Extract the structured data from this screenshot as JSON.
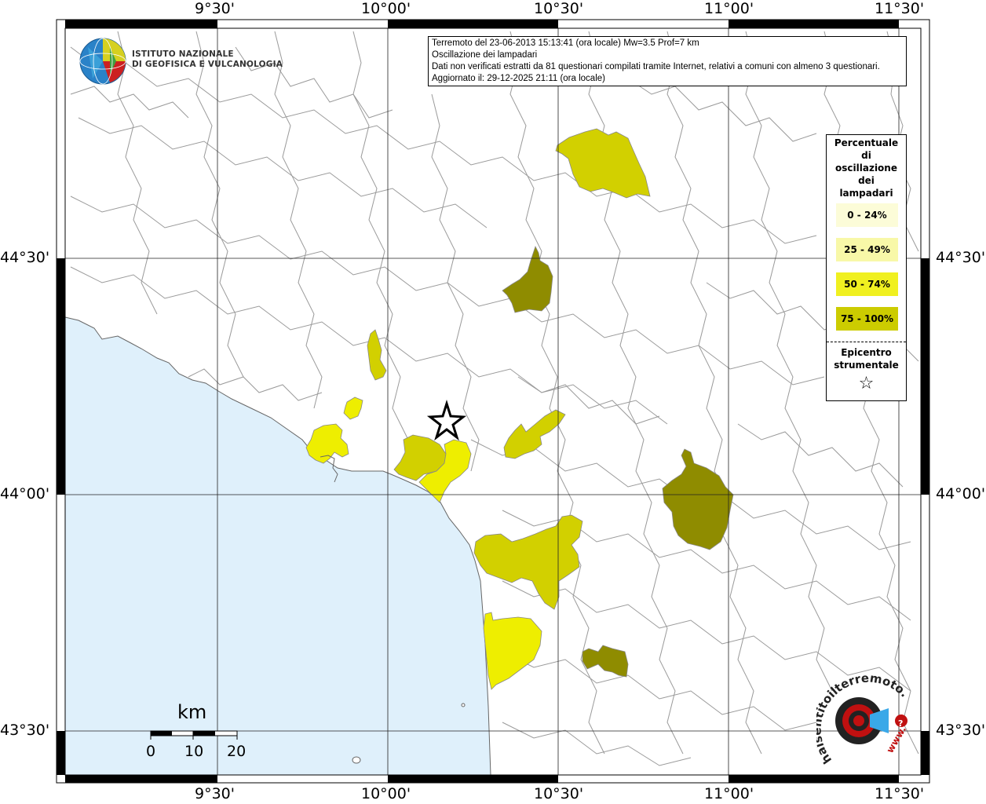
{
  "info": {
    "line1": "Terremoto del 23-06-2013 15:13:41 (ora locale) Mw=3.5 Prof=7 km",
    "line2": "Oscillazione dei lampadari",
    "line3": "Dati non verificati estratti da 81 questionari compilati tramite Internet, relativi a comuni con almeno 3 questionari.",
    "line4": "Aggiornato il: 29-12-2025 21:11 (ora locale)"
  },
  "logo": {
    "line1": "ISTITUTO NAZIONALE",
    "line2": "DI GEOFISICA E VULCANOLOGIA"
  },
  "axes": {
    "top": [
      "9°30'",
      "10°00'",
      "10°30'",
      "11°00'",
      "11°30'"
    ],
    "bottom": [
      "9°30'",
      "10°00'",
      "10°30'",
      "11°00'",
      "11°30'"
    ],
    "left": [
      "44°30'",
      "44°00'",
      "43°30'"
    ],
    "right": [
      "44°30'",
      "44°00'",
      "43°30'"
    ]
  },
  "legend": {
    "title": "Percentuale di oscillazione dei lampadari",
    "classes": [
      {
        "label": "0 - 24%",
        "color": "#fcfcd8"
      },
      {
        "label": "25 - 49%",
        "color": "#f8f8a8"
      },
      {
        "label": "50 - 74%",
        "color": "#f0f020"
      },
      {
        "label": "75 - 100%",
        "color": "#cccc00"
      }
    ],
    "epicenter_title": "Epicentro strumentale",
    "epicenter_symbol": "☆"
  },
  "scale_bar": {
    "unit": "km",
    "ticks": [
      "0",
      "10",
      "20"
    ]
  },
  "badge": {
    "text": "haisentitoilterremoto.it",
    "url": "www.",
    "question": "?"
  },
  "colors": {
    "sea": "#dff0fb",
    "land": "#ffffff",
    "borders": "#9a9a9a",
    "class_25_49": "#f8f8a8",
    "class_50_74": "#eeee00",
    "class_75_100_light": "#d2d000",
    "class_75_100_dark": "#8f8c00"
  }
}
